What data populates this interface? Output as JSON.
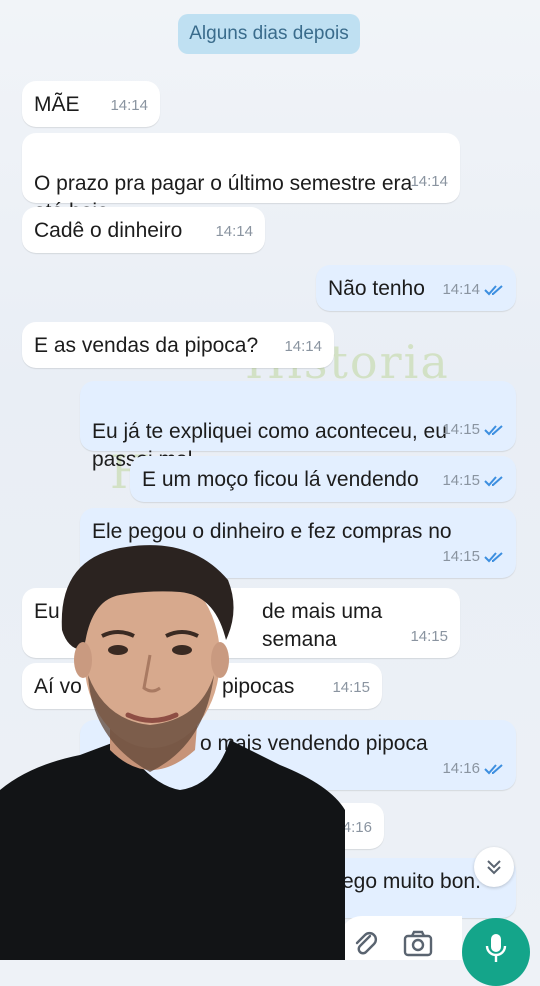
{
  "date_chip": "Alguns dias depois",
  "watermark": [
    "Historia newsh",
    "H"
  ],
  "messages": [
    {
      "side": "in",
      "text": "MÃE",
      "time": "14:14"
    },
    {
      "side": "in",
      "text": "O prazo pra pagar o último semestre era\naté hoje",
      "time": "14:14"
    },
    {
      "side": "in",
      "text": "Cadê o dinheiro",
      "time": "14:14"
    },
    {
      "side": "out",
      "text": "Não tenho",
      "time": "14:14"
    },
    {
      "side": "in",
      "text": "E as vendas da pipoca?",
      "time": "14:14"
    },
    {
      "side": "out",
      "text": "Eu já te expliquei como aconteceu, eu\npassei mal",
      "time": "14:15"
    },
    {
      "side": "out",
      "text": "E um moço ficou lá vendendo",
      "time": "14:15"
    },
    {
      "side": "out",
      "text": "Ele pegou o dinheiro e fez compras no",
      "time": "14:15"
    },
    {
      "side": "in",
      "text": "Eu",
      "text2": "de mais uma semana",
      "time": "14:15"
    },
    {
      "side": "in",
      "text": "Aí vo",
      "text2": "pipocas",
      "time": "14:15"
    },
    {
      "side": "out",
      "text": "o mais vendendo pipoca",
      "time": "14:16"
    },
    {
      "side": "in",
      "text": "",
      "time": "4:16"
    },
    {
      "side": "out",
      "text": "ego muito bon.",
      "time": ""
    }
  ],
  "colors": {
    "incoming_bubble": "#ffffff",
    "outgoing_bubble": "#e3efff",
    "read_check": "#3d8fe0",
    "mic_button": "#14a58a",
    "date_chip": "#bfe0f2"
  },
  "icons": {
    "scroll_down": "double-chevron-down-icon",
    "attach": "paperclip-icon",
    "camera": "camera-icon",
    "mic": "microphone-icon"
  }
}
